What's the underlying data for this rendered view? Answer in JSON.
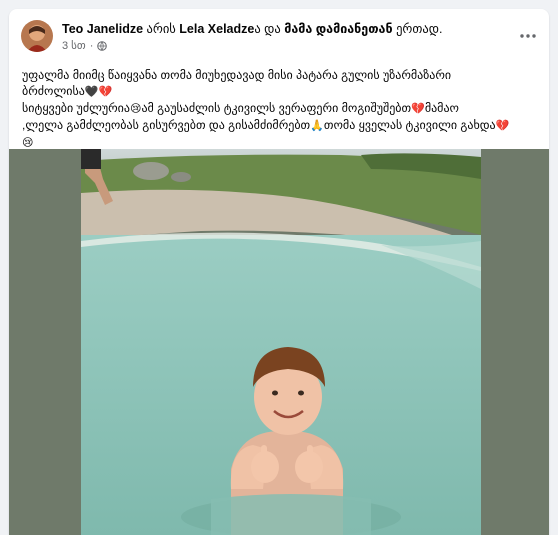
{
  "post": {
    "author": "Teo Janelidze",
    "connector_1": " არის ",
    "tagged": "Lela Xeladze",
    "connector_2": "ა და ",
    "with": "მამა დამიანეთან",
    "connector_3": " ერთად.",
    "time": "3 სთ",
    "separator": "·",
    "privacy_icon": "globe-icon",
    "more_icon": "more-options-icon",
    "text_line_1": "უფალმა მიიმც წაიყვანა თომა მიუხედავად მისი პატარა გულის უზარმაზარი",
    "text_line_2a": "ბრძოლისა",
    "text_line_2_emoji": "🖤💔",
    "text_line_3a": "სიტყვები უძლურია",
    "text_line_3_emoji_1": "😢",
    "text_line_3b": "ამ გაუსაძლის ტკივილს ვერაფერი მოგიშუშებთ",
    "text_line_3_emoji_2": "💔",
    "text_line_3c": "მამაო",
    "text_line_4a": ",ლელა გამძლეობას გისურვებთ და გისამძიმრებთ",
    "text_line_4_emoji_1": "🙏",
    "text_line_4b": "თომა ყველას ტკივილი გახდა",
    "text_line_4_emoji_2": "💔",
    "text_line_5_emoji": "😢"
  },
  "colors": {
    "background": "#f0f2f5",
    "card": "#ffffff",
    "secondary_text": "#65676b",
    "water": "#8fc7bd",
    "grass": "#6b8a4a"
  }
}
